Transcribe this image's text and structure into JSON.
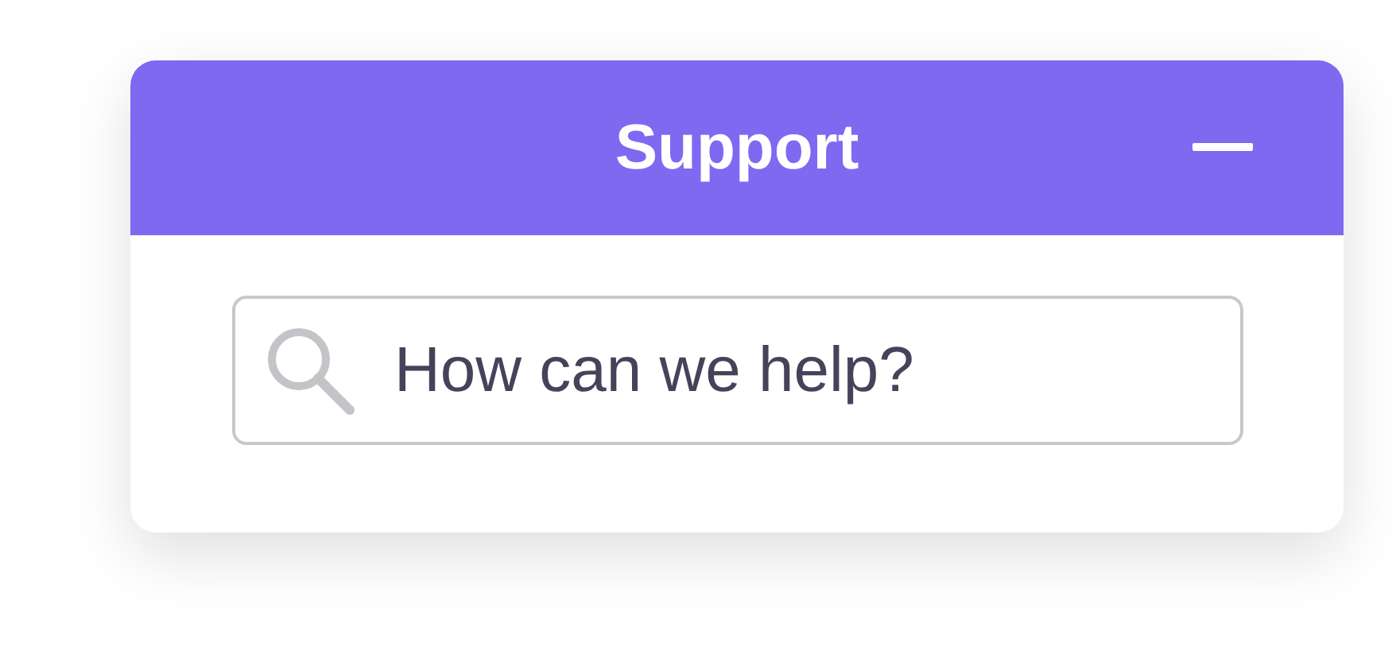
{
  "widget": {
    "title": "Support"
  },
  "search": {
    "placeholder": "How can we help?"
  }
}
